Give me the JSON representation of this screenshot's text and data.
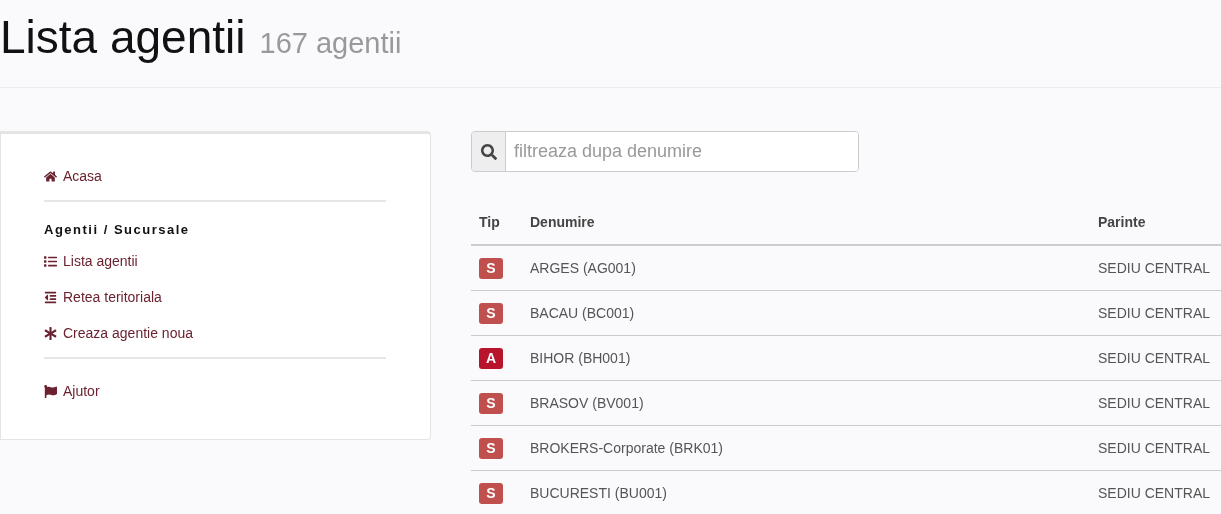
{
  "header": {
    "title": "Lista agentii",
    "count": "167 agentii"
  },
  "sidebar": {
    "sections": [
      {
        "items": [
          {
            "label": "Acasa"
          }
        ]
      },
      {
        "heading": "Agentii / Sucursale",
        "items": [
          {
            "label": "Lista agentii"
          },
          {
            "label": "Retea teritoriala"
          },
          {
            "label": "Creaza agentie noua"
          }
        ]
      },
      {
        "items": [
          {
            "label": "Ajutor"
          }
        ]
      }
    ]
  },
  "search": {
    "placeholder": "filtreaza dupa denumire"
  },
  "table": {
    "columns": [
      "Tip",
      "Denumire",
      "Parinte"
    ],
    "rows": [
      {
        "type": "S",
        "color": "#c0504d",
        "name": "ARGES (AG001)",
        "parent": "SEDIU CENTRAL"
      },
      {
        "type": "S",
        "color": "#c0504d",
        "name": "BACAU (BC001)",
        "parent": "SEDIU CENTRAL"
      },
      {
        "type": "A",
        "color": "#b8142b",
        "name": "BIHOR (BH001)",
        "parent": "SEDIU CENTRAL"
      },
      {
        "type": "S",
        "color": "#c0504d",
        "name": "BRASOV (BV001)",
        "parent": "SEDIU CENTRAL"
      },
      {
        "type": "S",
        "color": "#c0504d",
        "name": "BROKERS-Corporate (BRK01)",
        "parent": "SEDIU CENTRAL"
      },
      {
        "type": "S",
        "color": "#c0504d",
        "name": "BUCURESTI (BU001)",
        "parent": "SEDIU CENTRAL"
      }
    ]
  }
}
